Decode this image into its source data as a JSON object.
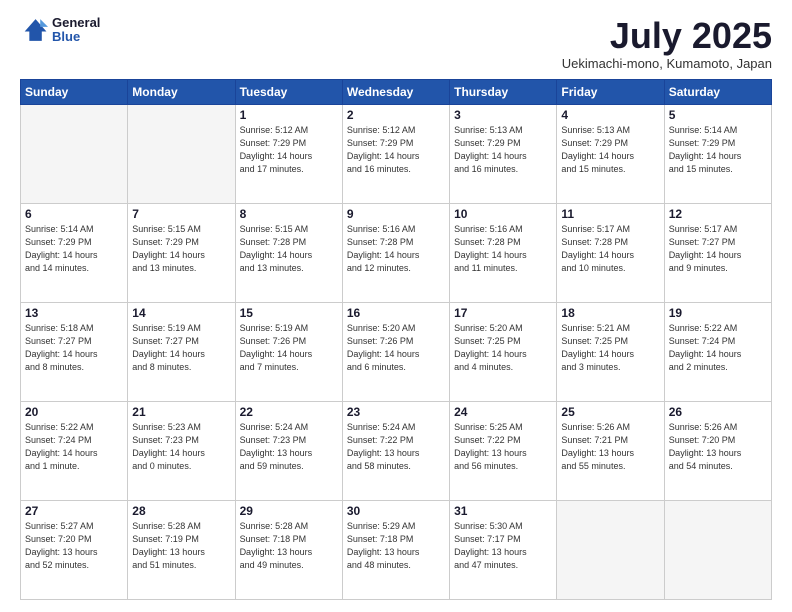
{
  "header": {
    "logo_line1": "General",
    "logo_line2": "Blue",
    "title": "July 2025",
    "subtitle": "Uekimachi-mono, Kumamoto, Japan"
  },
  "days_of_week": [
    "Sunday",
    "Monday",
    "Tuesday",
    "Wednesday",
    "Thursday",
    "Friday",
    "Saturday"
  ],
  "weeks": [
    [
      {
        "day": "",
        "info": ""
      },
      {
        "day": "",
        "info": ""
      },
      {
        "day": "1",
        "info": "Sunrise: 5:12 AM\nSunset: 7:29 PM\nDaylight: 14 hours\nand 17 minutes."
      },
      {
        "day": "2",
        "info": "Sunrise: 5:12 AM\nSunset: 7:29 PM\nDaylight: 14 hours\nand 16 minutes."
      },
      {
        "day": "3",
        "info": "Sunrise: 5:13 AM\nSunset: 7:29 PM\nDaylight: 14 hours\nand 16 minutes."
      },
      {
        "day": "4",
        "info": "Sunrise: 5:13 AM\nSunset: 7:29 PM\nDaylight: 14 hours\nand 15 minutes."
      },
      {
        "day": "5",
        "info": "Sunrise: 5:14 AM\nSunset: 7:29 PM\nDaylight: 14 hours\nand 15 minutes."
      }
    ],
    [
      {
        "day": "6",
        "info": "Sunrise: 5:14 AM\nSunset: 7:29 PM\nDaylight: 14 hours\nand 14 minutes."
      },
      {
        "day": "7",
        "info": "Sunrise: 5:15 AM\nSunset: 7:29 PM\nDaylight: 14 hours\nand 13 minutes."
      },
      {
        "day": "8",
        "info": "Sunrise: 5:15 AM\nSunset: 7:28 PM\nDaylight: 14 hours\nand 13 minutes."
      },
      {
        "day": "9",
        "info": "Sunrise: 5:16 AM\nSunset: 7:28 PM\nDaylight: 14 hours\nand 12 minutes."
      },
      {
        "day": "10",
        "info": "Sunrise: 5:16 AM\nSunset: 7:28 PM\nDaylight: 14 hours\nand 11 minutes."
      },
      {
        "day": "11",
        "info": "Sunrise: 5:17 AM\nSunset: 7:28 PM\nDaylight: 14 hours\nand 10 minutes."
      },
      {
        "day": "12",
        "info": "Sunrise: 5:17 AM\nSunset: 7:27 PM\nDaylight: 14 hours\nand 9 minutes."
      }
    ],
    [
      {
        "day": "13",
        "info": "Sunrise: 5:18 AM\nSunset: 7:27 PM\nDaylight: 14 hours\nand 8 minutes."
      },
      {
        "day": "14",
        "info": "Sunrise: 5:19 AM\nSunset: 7:27 PM\nDaylight: 14 hours\nand 8 minutes."
      },
      {
        "day": "15",
        "info": "Sunrise: 5:19 AM\nSunset: 7:26 PM\nDaylight: 14 hours\nand 7 minutes."
      },
      {
        "day": "16",
        "info": "Sunrise: 5:20 AM\nSunset: 7:26 PM\nDaylight: 14 hours\nand 6 minutes."
      },
      {
        "day": "17",
        "info": "Sunrise: 5:20 AM\nSunset: 7:25 PM\nDaylight: 14 hours\nand 4 minutes."
      },
      {
        "day": "18",
        "info": "Sunrise: 5:21 AM\nSunset: 7:25 PM\nDaylight: 14 hours\nand 3 minutes."
      },
      {
        "day": "19",
        "info": "Sunrise: 5:22 AM\nSunset: 7:24 PM\nDaylight: 14 hours\nand 2 minutes."
      }
    ],
    [
      {
        "day": "20",
        "info": "Sunrise: 5:22 AM\nSunset: 7:24 PM\nDaylight: 14 hours\nand 1 minute."
      },
      {
        "day": "21",
        "info": "Sunrise: 5:23 AM\nSunset: 7:23 PM\nDaylight: 14 hours\nand 0 minutes."
      },
      {
        "day": "22",
        "info": "Sunrise: 5:24 AM\nSunset: 7:23 PM\nDaylight: 13 hours\nand 59 minutes."
      },
      {
        "day": "23",
        "info": "Sunrise: 5:24 AM\nSunset: 7:22 PM\nDaylight: 13 hours\nand 58 minutes."
      },
      {
        "day": "24",
        "info": "Sunrise: 5:25 AM\nSunset: 7:22 PM\nDaylight: 13 hours\nand 56 minutes."
      },
      {
        "day": "25",
        "info": "Sunrise: 5:26 AM\nSunset: 7:21 PM\nDaylight: 13 hours\nand 55 minutes."
      },
      {
        "day": "26",
        "info": "Sunrise: 5:26 AM\nSunset: 7:20 PM\nDaylight: 13 hours\nand 54 minutes."
      }
    ],
    [
      {
        "day": "27",
        "info": "Sunrise: 5:27 AM\nSunset: 7:20 PM\nDaylight: 13 hours\nand 52 minutes."
      },
      {
        "day": "28",
        "info": "Sunrise: 5:28 AM\nSunset: 7:19 PM\nDaylight: 13 hours\nand 51 minutes."
      },
      {
        "day": "29",
        "info": "Sunrise: 5:28 AM\nSunset: 7:18 PM\nDaylight: 13 hours\nand 49 minutes."
      },
      {
        "day": "30",
        "info": "Sunrise: 5:29 AM\nSunset: 7:18 PM\nDaylight: 13 hours\nand 48 minutes."
      },
      {
        "day": "31",
        "info": "Sunrise: 5:30 AM\nSunset: 7:17 PM\nDaylight: 13 hours\nand 47 minutes."
      },
      {
        "day": "",
        "info": ""
      },
      {
        "day": "",
        "info": ""
      }
    ]
  ]
}
